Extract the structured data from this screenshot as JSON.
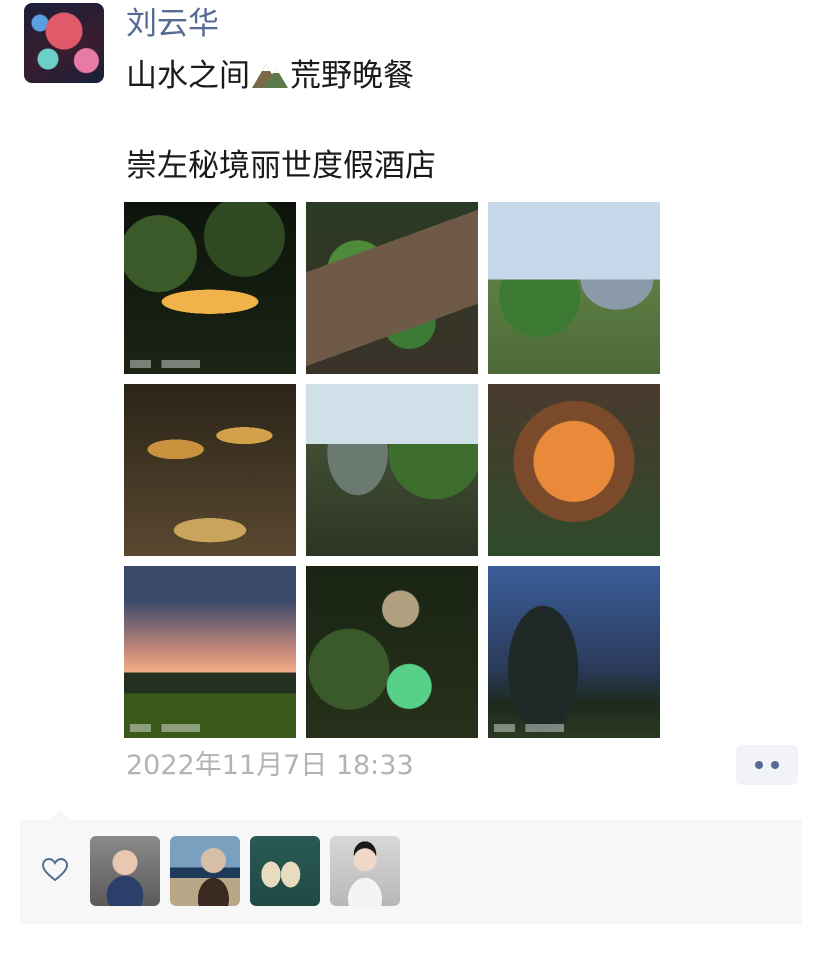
{
  "post": {
    "author": "刘云华",
    "line1_before": "山水之间",
    "line1_after": "荒野晚餐",
    "line2": "崇左秘境丽世度假酒店",
    "timestamp": "2022年11月7日 18:33"
  },
  "photos": [
    {
      "icon": "night-dinner-table-photo"
    },
    {
      "icon": "leaf-table-setting-photo"
    },
    {
      "icon": "outdoor-banquet-photo"
    },
    {
      "icon": "chefs-cooking-photo"
    },
    {
      "icon": "karst-mountain-kitchen-photo"
    },
    {
      "icon": "grill-fire-photo"
    },
    {
      "icon": "sunset-karst-field-photo"
    },
    {
      "icon": "green-cocktail-photo"
    },
    {
      "icon": "karst-night-light-photo"
    }
  ],
  "likes": {
    "users": [
      {
        "icon": "liker-avatar-woman-sitting"
      },
      {
        "icon": "liker-avatar-man-beach"
      },
      {
        "icon": "liker-avatar-artwork"
      },
      {
        "icon": "liker-avatar-woman-white"
      }
    ]
  },
  "colors": {
    "author_name": "#566b94",
    "timestamp": "#b3b3b3",
    "likes_bg": "#f7f7f7"
  }
}
